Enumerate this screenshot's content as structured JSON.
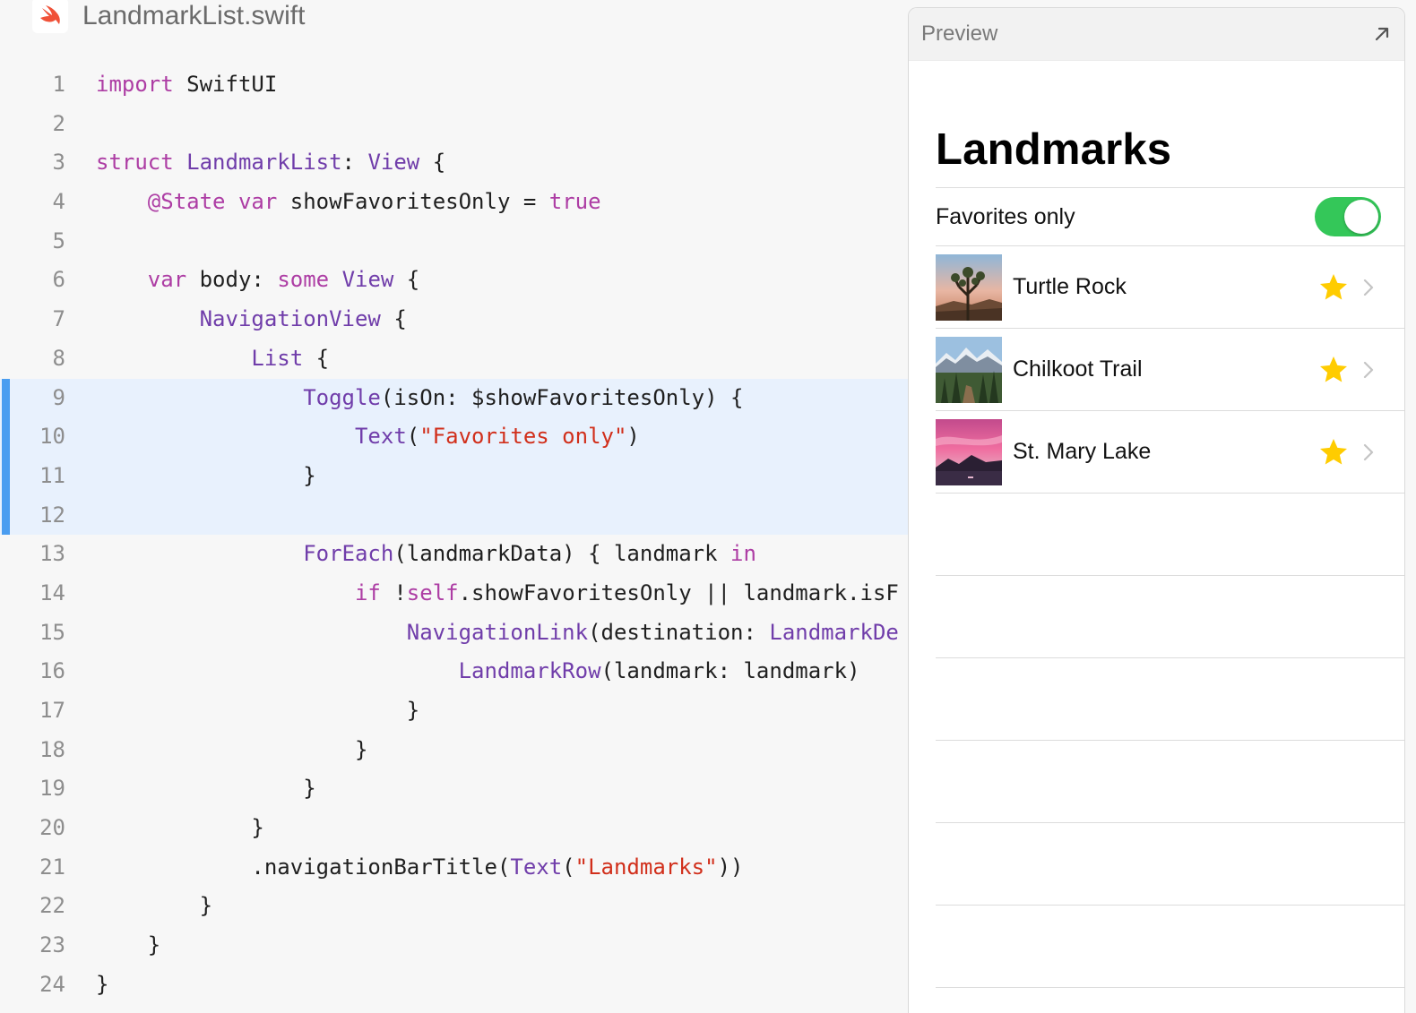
{
  "editor": {
    "file_name": "LandmarkList.swift",
    "lines": [
      {
        "n": "1",
        "tokens": [
          {
            "t": "kw",
            "v": "import"
          },
          {
            "t": "pl",
            "v": " SwiftUI"
          }
        ]
      },
      {
        "n": "2",
        "tokens": []
      },
      {
        "n": "3",
        "tokens": [
          {
            "t": "kw",
            "v": "struct"
          },
          {
            "t": "pl",
            "v": " "
          },
          {
            "t": "ty",
            "v": "LandmarkList"
          },
          {
            "t": "pl",
            "v": ": "
          },
          {
            "t": "ty",
            "v": "View"
          },
          {
            "t": "pl",
            "v": " {"
          }
        ]
      },
      {
        "n": "4",
        "tokens": [
          {
            "t": "pl",
            "v": "    "
          },
          {
            "t": "kw",
            "v": "@State"
          },
          {
            "t": "pl",
            "v": " "
          },
          {
            "t": "kw",
            "v": "var"
          },
          {
            "t": "pl",
            "v": " showFavoritesOnly = "
          },
          {
            "t": "kw",
            "v": "true"
          }
        ]
      },
      {
        "n": "5",
        "tokens": []
      },
      {
        "n": "6",
        "tokens": [
          {
            "t": "pl",
            "v": "    "
          },
          {
            "t": "kw",
            "v": "var"
          },
          {
            "t": "pl",
            "v": " body: "
          },
          {
            "t": "kw",
            "v": "some"
          },
          {
            "t": "pl",
            "v": " "
          },
          {
            "t": "ty",
            "v": "View"
          },
          {
            "t": "pl",
            "v": " {"
          }
        ]
      },
      {
        "n": "7",
        "tokens": [
          {
            "t": "pl",
            "v": "        "
          },
          {
            "t": "ty",
            "v": "NavigationView"
          },
          {
            "t": "pl",
            "v": " {"
          }
        ]
      },
      {
        "n": "8",
        "tokens": [
          {
            "t": "pl",
            "v": "            "
          },
          {
            "t": "ty",
            "v": "List"
          },
          {
            "t": "pl",
            "v": " {"
          }
        ]
      },
      {
        "n": "9",
        "hl": true,
        "tokens": [
          {
            "t": "pl",
            "v": "                "
          },
          {
            "t": "ty",
            "v": "Toggle"
          },
          {
            "t": "pl",
            "v": "(isOn: $showFavoritesOnly) {"
          }
        ]
      },
      {
        "n": "10",
        "hl": true,
        "tokens": [
          {
            "t": "pl",
            "v": "                    "
          },
          {
            "t": "ty",
            "v": "Text"
          },
          {
            "t": "pl",
            "v": "("
          },
          {
            "t": "str",
            "v": "\"Favorites only\""
          },
          {
            "t": "pl",
            "v": ")"
          }
        ]
      },
      {
        "n": "11",
        "hl": true,
        "tokens": [
          {
            "t": "pl",
            "v": "                }"
          }
        ]
      },
      {
        "n": "12",
        "hl": true,
        "tokens": []
      },
      {
        "n": "13",
        "tokens": [
          {
            "t": "pl",
            "v": "                "
          },
          {
            "t": "ty",
            "v": "ForEach"
          },
          {
            "t": "pl",
            "v": "(landmarkData) { landmark "
          },
          {
            "t": "kw",
            "v": "in"
          }
        ]
      },
      {
        "n": "14",
        "tokens": [
          {
            "t": "pl",
            "v": "                    "
          },
          {
            "t": "kw",
            "v": "if"
          },
          {
            "t": "pl",
            "v": " !"
          },
          {
            "t": "kw",
            "v": "self"
          },
          {
            "t": "pl",
            "v": ".showFavoritesOnly || landmark.isF"
          }
        ]
      },
      {
        "n": "15",
        "tokens": [
          {
            "t": "pl",
            "v": "                        "
          },
          {
            "t": "ty",
            "v": "NavigationLink"
          },
          {
            "t": "pl",
            "v": "(destination: "
          },
          {
            "t": "ty",
            "v": "LandmarkDe"
          }
        ]
      },
      {
        "n": "16",
        "tokens": [
          {
            "t": "pl",
            "v": "                            "
          },
          {
            "t": "ty",
            "v": "LandmarkRow"
          },
          {
            "t": "pl",
            "v": "(landmark: landmark)"
          }
        ]
      },
      {
        "n": "17",
        "tokens": [
          {
            "t": "pl",
            "v": "                        }"
          }
        ]
      },
      {
        "n": "18",
        "tokens": [
          {
            "t": "pl",
            "v": "                    }"
          }
        ]
      },
      {
        "n": "19",
        "tokens": [
          {
            "t": "pl",
            "v": "                }"
          }
        ]
      },
      {
        "n": "20",
        "tokens": [
          {
            "t": "pl",
            "v": "            }"
          }
        ]
      },
      {
        "n": "21",
        "tokens": [
          {
            "t": "pl",
            "v": "            .navigationBarTitle("
          },
          {
            "t": "ty",
            "v": "Text"
          },
          {
            "t": "pl",
            "v": "("
          },
          {
            "t": "str",
            "v": "\"Landmarks\""
          },
          {
            "t": "pl",
            "v": "))"
          }
        ]
      },
      {
        "n": "22",
        "tokens": [
          {
            "t": "pl",
            "v": "        }"
          }
        ]
      },
      {
        "n": "23",
        "tokens": [
          {
            "t": "pl",
            "v": "    }"
          }
        ]
      },
      {
        "n": "24",
        "tokens": [
          {
            "t": "pl",
            "v": "}"
          }
        ]
      }
    ]
  },
  "preview": {
    "header_title": "Preview",
    "expand_icon": "arrow-up-right-icon",
    "nav_title": "Landmarks",
    "toggle": {
      "label": "Favorites only",
      "is_on": true
    },
    "rows": [
      {
        "name": "Turtle Rock",
        "favorite": true,
        "thumb": "desert-tree"
      },
      {
        "name": "Chilkoot Trail",
        "favorite": true,
        "thumb": "mountain-forest"
      },
      {
        "name": "St. Mary Lake",
        "favorite": true,
        "thumb": "sunset-lake"
      }
    ],
    "empty_rows": 6
  },
  "colors": {
    "keyword": "#ad3da4",
    "type": "#703daa",
    "string": "#d12f1b",
    "highlight_bg": "#e8f1fd",
    "highlight_bar": "#4a9df0",
    "toggle_on": "#34c759",
    "star": "#ffcc00"
  }
}
